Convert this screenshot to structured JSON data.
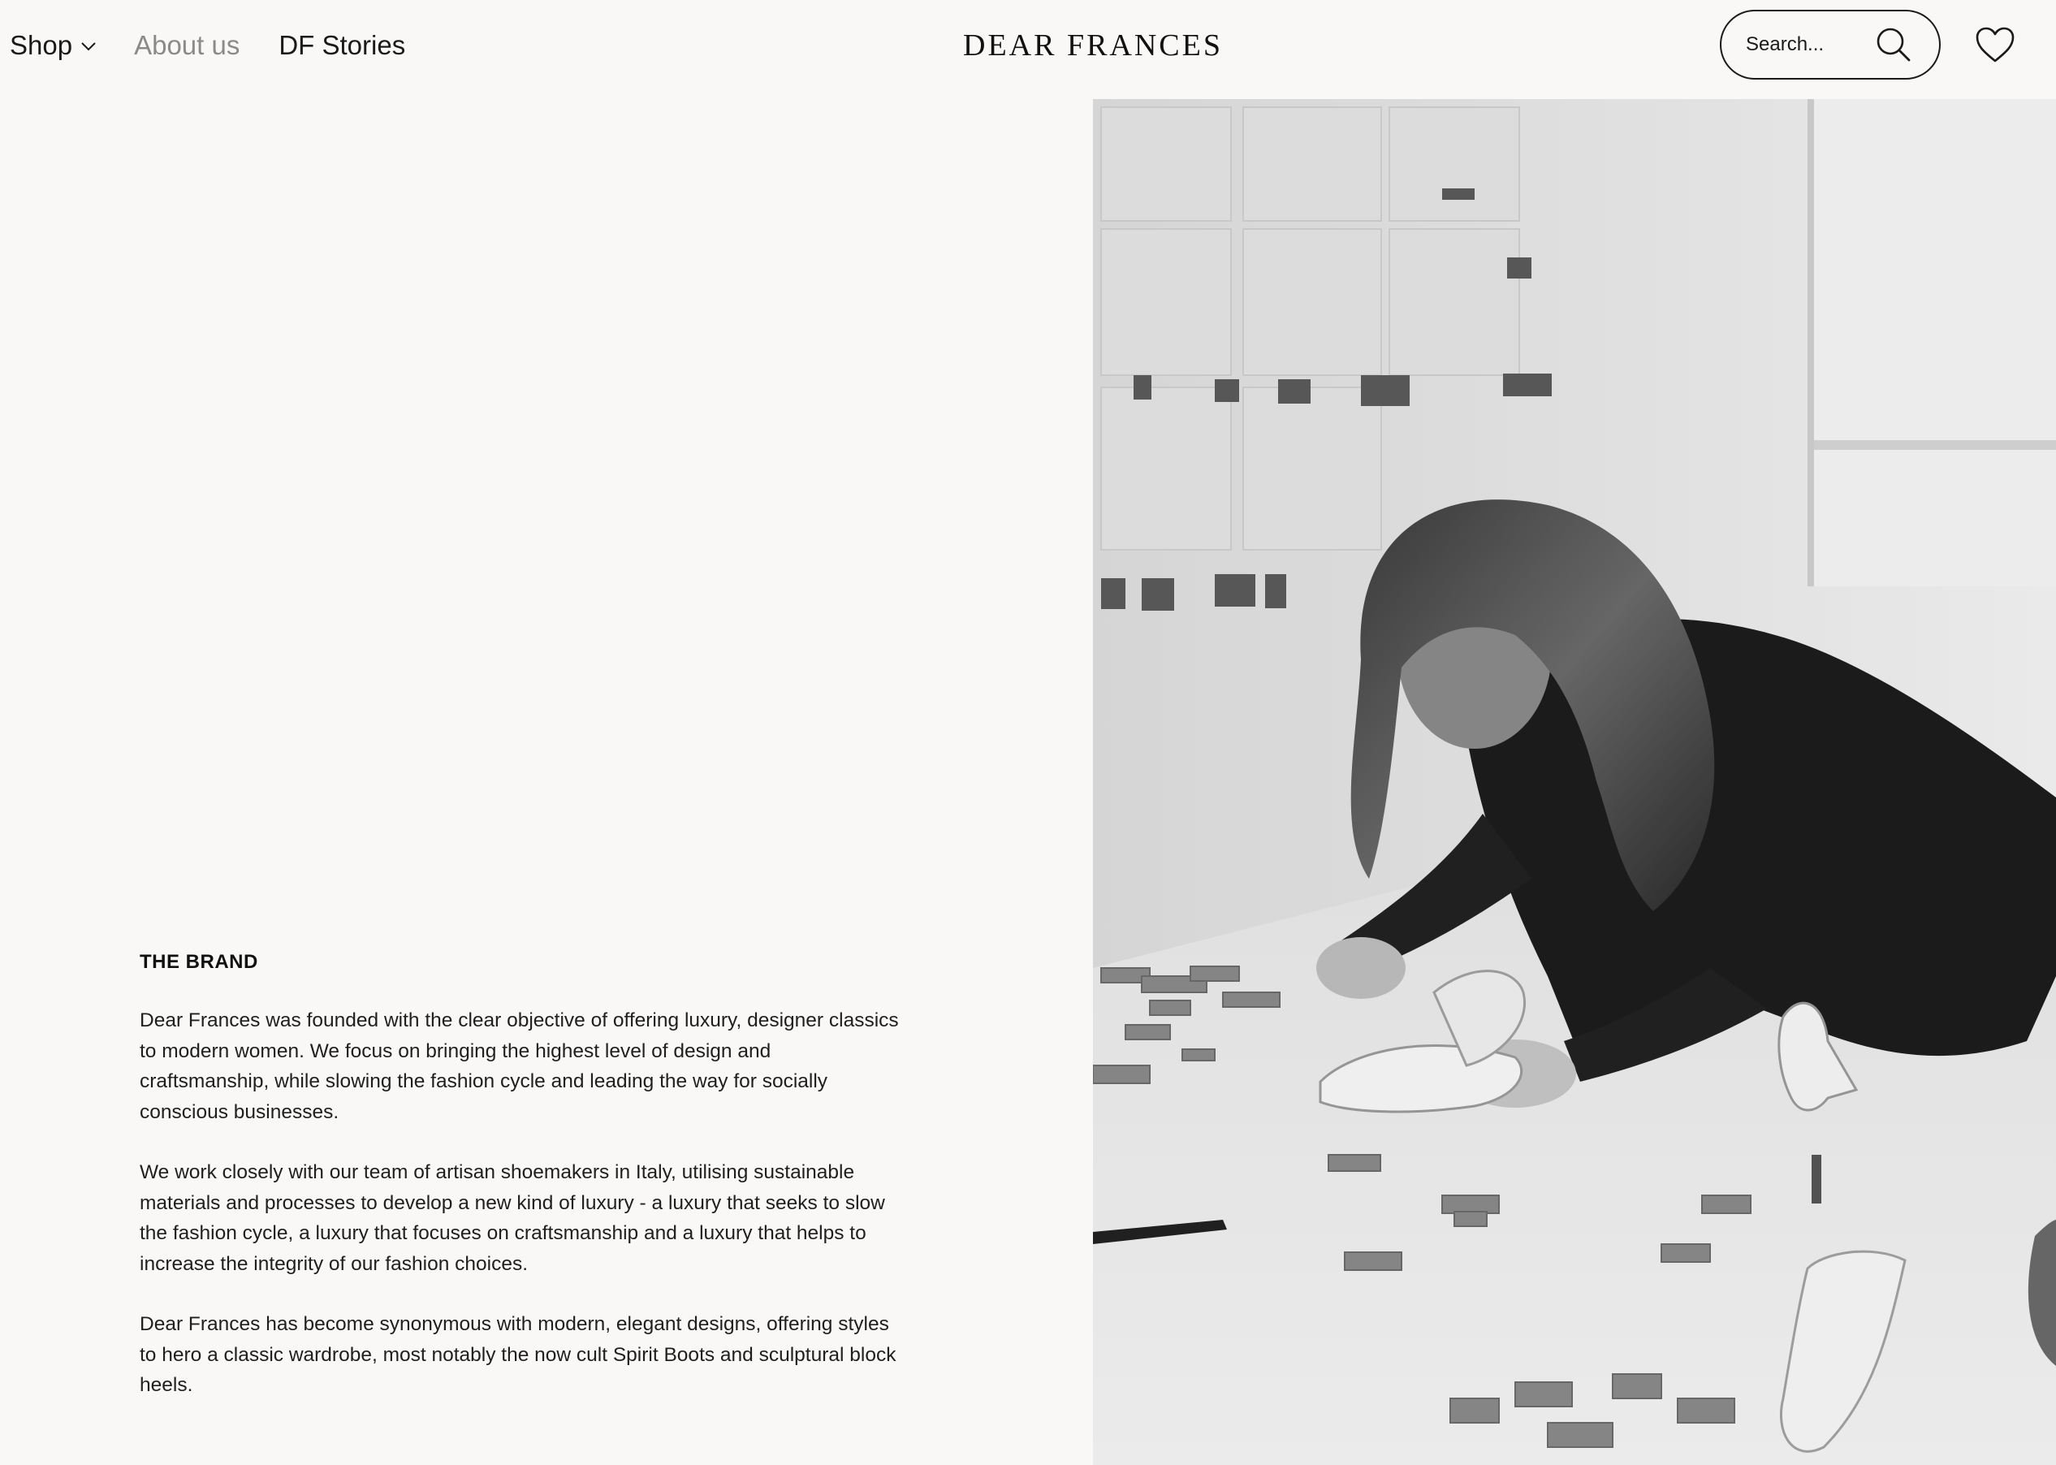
{
  "header": {
    "nav": {
      "shop": "Shop",
      "about": "About us",
      "stories": "DF Stories"
    },
    "brand": "DEAR FRANCES",
    "search": {
      "placeholder": "Search...",
      "icon": "search-icon"
    },
    "wishlist_icon": "heart-icon"
  },
  "brand_section": {
    "title": "THE BRAND",
    "paragraphs": [
      "Dear Frances was founded with the clear objective of offering luxury, designer classics to modern women. We focus on bringing the highest level of design and craftsmanship, while slowing the fashion cycle and leading the way for socially conscious businesses.",
      "We work closely with our team of artisan shoemakers in Italy, utilising sustainable materials and processes to develop a new kind of luxury - a luxury that seeks to slow the fashion cycle, a luxury that focuses on craftsmanship and a luxury that helps to increase the integrity of our fashion choices.",
      "Dear Frances has become synonymous with modern, elegant designs, offering styles to hero a classic wardrobe, most notably the now cult Spirit Boots and sculptural block heels."
    ]
  },
  "colors": {
    "background": "#f9f8f6",
    "text": "#1a1a1a",
    "active_nav": "#8a8a8a"
  }
}
